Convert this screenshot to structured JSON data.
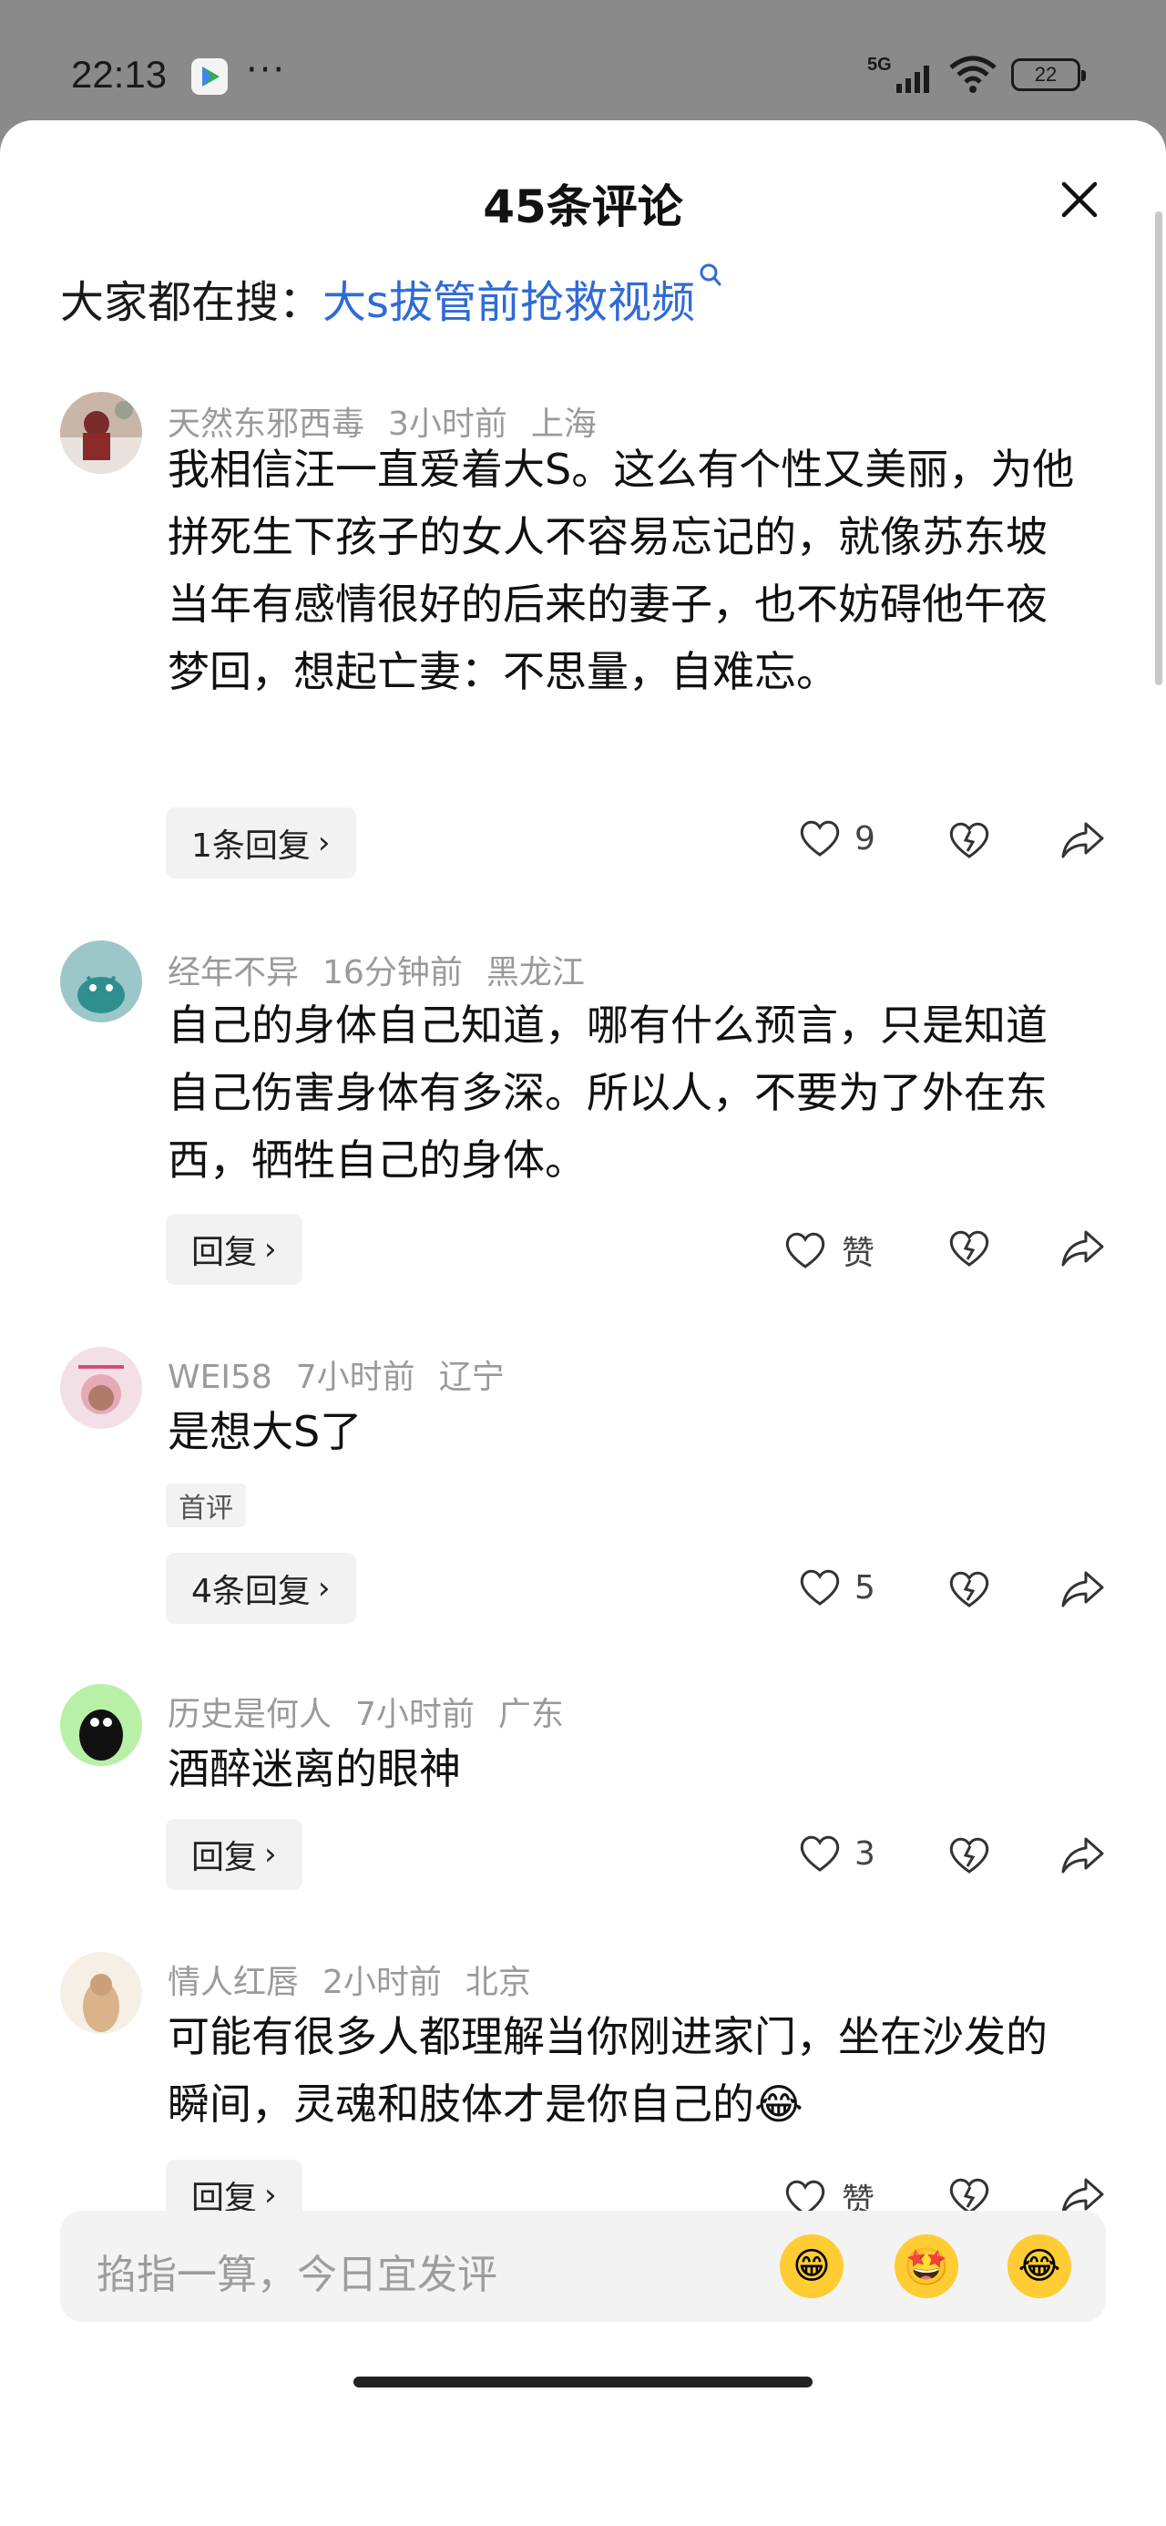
{
  "status_bar": {
    "time": "22:13",
    "dots": "···",
    "network": "5G",
    "battery": "22"
  },
  "sheet": {
    "title": "45条评论",
    "search_prefix": "大家都在搜：",
    "search_keyword": "大s拔管前抢救视频"
  },
  "comments": [
    {
      "user": "天然东邪西毒",
      "time": "3小时前",
      "location": "上海",
      "text": "我相信汪一直爱着大S。这么有个性又美丽，为他拼死生下孩子的女人不容易忘记的，就像苏东坡当年有感情很好的后来的妻子，也不妨碍他午夜梦回，想起亡妻：不思量，自难忘。",
      "reply_label": "1条回复",
      "likes": "9"
    },
    {
      "user": "经年不异",
      "time": "16分钟前",
      "location": "黑龙江",
      "text": "自己的身体自己知道，哪有什么预言，只是知道自己伤害身体有多深。所以人，不要为了外在东西，牺牲自己的身体。",
      "reply_label": "回复",
      "likes": "赞"
    },
    {
      "user": "WEI58",
      "time": "7小时前",
      "location": "辽宁",
      "text": "是想大S了",
      "tag": "首评",
      "reply_label": "4条回复",
      "likes": "5"
    },
    {
      "user": "历史是何人",
      "time": "7小时前",
      "location": "广东",
      "text": "酒醉迷离的眼神",
      "reply_label": "回复",
      "likes": "3"
    },
    {
      "user": "情人红唇",
      "time": "2小时前",
      "location": "北京",
      "text": "可能有很多人都理解当你刚进家门，坐在沙发的瞬间，灵魂和肢体才是你自己的",
      "text_emoji": "😂",
      "reply_label": "回复",
      "likes": "赞"
    }
  ],
  "input": {
    "placeholder": "掐指一算，今日宜发评"
  },
  "emojis": [
    "😁",
    "🤩",
    "😂"
  ]
}
